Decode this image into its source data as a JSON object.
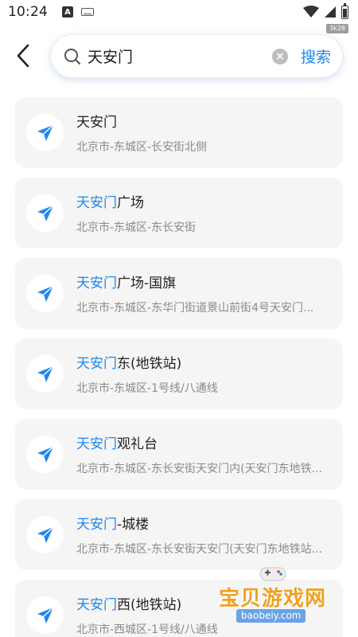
{
  "status_bar": {
    "time": "10:24",
    "badge": "3k28"
  },
  "search": {
    "query": "天安门",
    "button_label": "搜索"
  },
  "results": [
    {
      "highlight": "",
      "rest": "天安门",
      "address": "北京市-东城区-长安街北侧"
    },
    {
      "highlight": "天安门",
      "rest": "广场",
      "address": "北京市-东城区-东长安街"
    },
    {
      "highlight": "天安门",
      "rest": "广场-国旗",
      "address": "北京市-东城区-东华门街道景山前街4号天安门..."
    },
    {
      "highlight": "天安门",
      "rest": "东(地铁站)",
      "address": "北京市-东城区-1号线/八通线"
    },
    {
      "highlight": "天安门",
      "rest": "观礼台",
      "address": "北京市-东城区-东长安街天安门内(天安门东地铁..."
    },
    {
      "highlight": "天安门",
      "rest": "-城楼",
      "address": "北京市-东城区-东长安街天安门(天安门东地铁站..."
    },
    {
      "highlight": "天安门",
      "rest": "西(地铁站)",
      "address": "北京市-西城区-1号线/八通线"
    }
  ],
  "watermark": {
    "title": "宝贝游戏网",
    "domain": "baobeiy.com"
  },
  "colors": {
    "accent": "#1e86ef",
    "card_bg": "#f5f5f5"
  }
}
